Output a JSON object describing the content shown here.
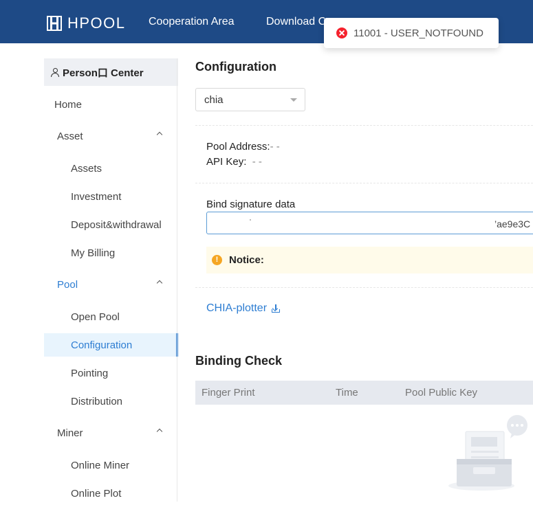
{
  "header": {
    "logo_text": "HPOOL",
    "nav": [
      "Cooperation Area",
      "Download C"
    ]
  },
  "toast": {
    "message": "11001 - USER_NOTFOUND",
    "icon": "error-circle-icon",
    "color": "#f5222d"
  },
  "sidebar": {
    "header": "Person口 Center",
    "items": [
      {
        "label": "Home",
        "type": "top"
      },
      {
        "label": "Asset",
        "type": "group",
        "expanded": true
      },
      {
        "label": "Assets",
        "type": "sub"
      },
      {
        "label": "Investment",
        "type": "sub"
      },
      {
        "label": "Deposit&withdrawal",
        "type": "sub"
      },
      {
        "label": "My Billing",
        "type": "sub"
      },
      {
        "label": "Pool",
        "type": "group",
        "expanded": true
      },
      {
        "label": "Open Pool",
        "type": "sub"
      },
      {
        "label": "Configuration",
        "type": "sub",
        "active": true
      },
      {
        "label": "Pointing",
        "type": "sub"
      },
      {
        "label": "Distribution",
        "type": "sub"
      },
      {
        "label": "Miner",
        "type": "group",
        "expanded": true
      },
      {
        "label": "Online Miner",
        "type": "sub"
      },
      {
        "label": "Online Plot",
        "type": "sub"
      }
    ]
  },
  "main": {
    "title": "Configuration",
    "coin_select": {
      "value": "chia"
    },
    "pool_address_label": "Pool Address:",
    "pool_address_value": "- -",
    "api_key_label": "API Key:",
    "api_key_value": "- -",
    "bind_label": "Bind signature data",
    "bind_value_visible": "’ae9e3C",
    "notice_label": "Notice:",
    "plotter_link": "CHIA-plotter",
    "binding_check_title": "Binding Check",
    "table_columns": [
      "Finger Print",
      "Time",
      "Pool Public Key"
    ]
  },
  "colors": {
    "header_bg": "#1e4a86",
    "accent": "#2d7dd2",
    "notice_bg": "#fffbea"
  }
}
